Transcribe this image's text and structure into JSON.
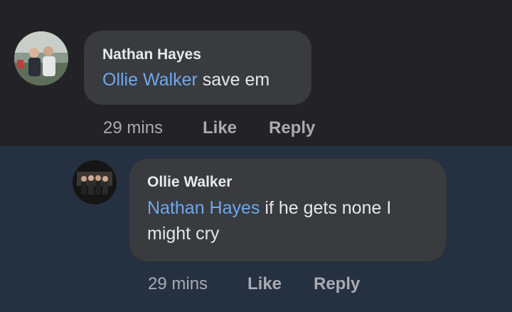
{
  "comments": [
    {
      "author": "Nathan Hayes",
      "mention": "Ollie Walker",
      "text": " save em",
      "time": "29 mins",
      "like_label": "Like",
      "reply_label": "Reply"
    },
    {
      "author": "Ollie Walker",
      "mention": "Nathan Hayes",
      "text": " if he gets none I might cry",
      "time": "29 mins",
      "like_label": "Like",
      "reply_label": "Reply"
    }
  ],
  "colors": {
    "mention": "#6ea8ec",
    "bubble": "#3a3b3f",
    "reply_background": "#253040"
  }
}
